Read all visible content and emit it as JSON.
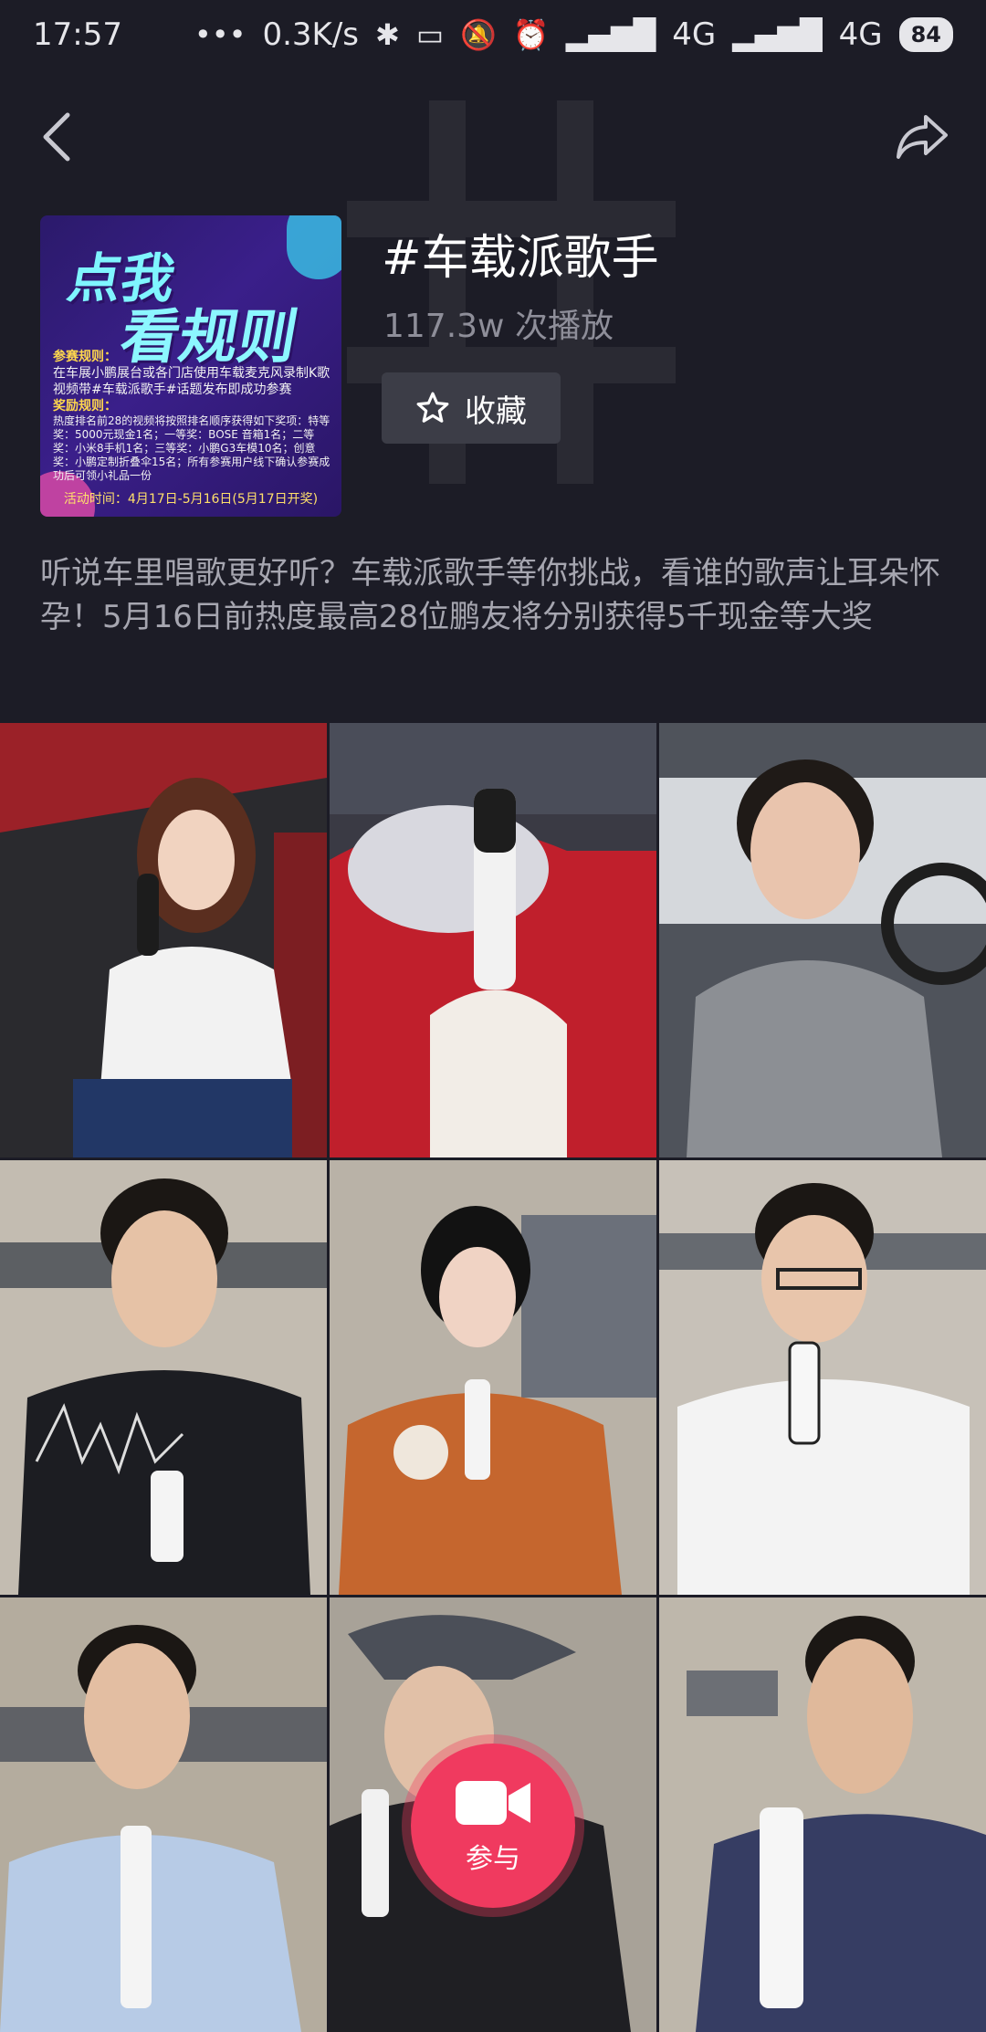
{
  "status_bar": {
    "time": "17:57",
    "network_speed": "0.3K/s",
    "signal1": "4G",
    "signal2": "4G",
    "battery": "84"
  },
  "nav": {
    "back_icon": "back-arrow-icon",
    "share_icon": "share-arrow-icon"
  },
  "topic": {
    "title": "#车载派歌手",
    "play_count": "117.3w 次播放",
    "favorite_label": "收藏",
    "description": "听说车里唱歌更好听？车载派歌手等你挑战，看谁的歌声让耳朵怀孕！5月16日前热度最高28位鹏友将分别获得5千现金等大奖"
  },
  "cover": {
    "title_line1": "点我",
    "title_line2": "看规则",
    "rules_heading": "参赛规则：",
    "rules_text": "在车展小鹏展台或各门店使用车载麦克风录制K歌视频带#车载派歌手#话题发布即成功参赛",
    "prize_heading": "奖励规则：",
    "prize_text": "热度排名前28的视频将按照排名顺序获得如下奖项：特等奖：5000元现金1名；一等奖：BOSE 音箱1名；二等奖：小米8手机1名；三等奖：小鹏G3车模10名；创意奖：小鹏定制折叠伞15名；所有参赛用户线下确认参赛成功后可领小礼品一份",
    "time_text": "活动时间：4月17日-5月16日(5月17日开奖)"
  },
  "videos": [
    {
      "id": 1,
      "bg": "#7a2a2e"
    },
    {
      "id": 2,
      "bg": "#8a2c30"
    },
    {
      "id": 3,
      "bg": "#5c6068"
    },
    {
      "id": 4,
      "bg": "#bfb7ab"
    },
    {
      "id": 5,
      "bg": "#b8b0a5"
    },
    {
      "id": 6,
      "bg": "#c5bfb6"
    },
    {
      "id": 7,
      "bg": "#b5ad9f"
    },
    {
      "id": 8,
      "bg": "#a9a39a"
    },
    {
      "id": 9,
      "bg": "#bdb6aa"
    }
  ],
  "join_button": {
    "label": "参与",
    "icon": "video-camera-icon",
    "color": "#f03a5f"
  }
}
